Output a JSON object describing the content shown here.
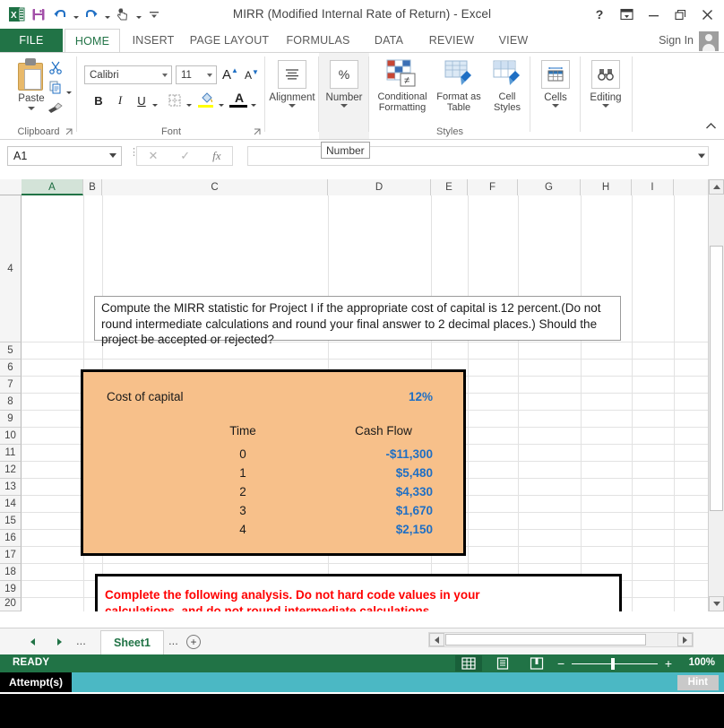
{
  "window": {
    "title": "MIRR (Modified Internal Rate of Return) - Excel",
    "help_icon": "?",
    "ribbon_display_icon": "ribbon-display-options-icon",
    "minimize_icon": "minimize-icon",
    "restore_icon": "restore-icon",
    "close_icon": "close-icon"
  },
  "quick_access": {
    "app_icon": "excel-app-icon",
    "save": "save-icon",
    "undo": "undo-icon",
    "redo": "redo-icon",
    "touch_mode": "touch-mouse-mode-icon",
    "customize": "customize-quick-access-icon"
  },
  "ribbon_tabs": [
    {
      "label": "FILE",
      "active": false
    },
    {
      "label": "HOME",
      "active": true
    },
    {
      "label": "INSERT",
      "active": false
    },
    {
      "label": "PAGE LAYOUT",
      "active": false
    },
    {
      "label": "FORMULAS",
      "active": false
    },
    {
      "label": "DATA",
      "active": false
    },
    {
      "label": "REVIEW",
      "active": false
    },
    {
      "label": "VIEW",
      "active": false
    }
  ],
  "account": {
    "sign_in": "Sign In",
    "avatar": "user-avatar-icon"
  },
  "ribbon": {
    "groups": [
      {
        "name": "Clipboard"
      },
      {
        "name": "Font"
      },
      {
        "name": "Styles"
      }
    ],
    "clipboard": {
      "paste_label": "Paste",
      "cut_icon": "scissors-icon",
      "copy_icon": "copy-icon",
      "format_painter_icon": "format-painter-icon",
      "group_label": "Clipboard"
    },
    "font": {
      "font_name": "Calibri",
      "font_size": "11",
      "grow_font": "A",
      "shrink_font": "A",
      "bold": "B",
      "italic": "I",
      "underline": "U",
      "borders_icon": "borders-icon",
      "fill_color_icon": "fill-color-icon",
      "font_color_icon": "font-color-icon",
      "group_label": "Font"
    },
    "alignment": {
      "label": "Alignment",
      "icon": "alignment-icon"
    },
    "number": {
      "label": "Number",
      "icon": "percent-icon"
    },
    "styles": {
      "conditional_formatting": "Conditional Formatting",
      "format_as_table": "Format as Table",
      "cell_styles": "Cell Styles",
      "group_label": "Styles"
    },
    "cells": {
      "label": "Cells",
      "icon": "cells-icon"
    },
    "editing": {
      "label": "Editing",
      "icon": "binoculars-icon"
    },
    "collapse_icon": "collapse-ribbon-icon"
  },
  "formula_bar": {
    "name_box_value": "A1",
    "cancel_icon": "cancel-icon",
    "enter_icon": "enter-icon",
    "function_icon": "fx",
    "formula_value": "",
    "expand_icon": "expand-formula-bar-icon"
  },
  "tooltip": {
    "text": "Number"
  },
  "sheet": {
    "columns": [
      "A",
      "B",
      "C",
      "D",
      "E",
      "F",
      "G",
      "H",
      "I"
    ],
    "selected_column": "A",
    "rows": [
      "4",
      "5",
      "6",
      "7",
      "8",
      "9",
      "10",
      "11",
      "12",
      "13",
      "14",
      "15",
      "16",
      "17",
      "18",
      "19",
      "20"
    ],
    "selected_cell": "A1",
    "question_text": "Compute the MIRR statistic for Project I if the appropriate cost of capital is 12 percent.(Do not round intermediate calculations and round your final answer to 2 decimal places.) Should the project be accepted or rejected?",
    "data_box": {
      "cost_of_capital_label": "Cost of capital",
      "cost_of_capital_value": "12%",
      "time_header": "Time",
      "cash_flow_header": "Cash Flow",
      "rows": [
        {
          "time": "0",
          "cash_flow": "-$11,300"
        },
        {
          "time": "1",
          "cash_flow": "$5,480"
        },
        {
          "time": "2",
          "cash_flow": "$4,330"
        },
        {
          "time": "3",
          "cash_flow": "$1,670"
        },
        {
          "time": "4",
          "cash_flow": "$2,150"
        }
      ],
      "fill_color": "#F7C08A",
      "value_color": "#1F6FC4"
    },
    "instruction_box": {
      "line1": "Complete the following analysis. Do not hard code values in your",
      "line2": "calculations, and do not round intermediate calculations.",
      "text_color": "#FF0000"
    }
  },
  "sheet_tabs": {
    "first_icon": "first-sheet-icon",
    "prev_icon": "previous-sheet-icon",
    "next_icon": "next-sheet-icon",
    "last_icon": "last-sheet-icon",
    "left_dots": "...",
    "right_dots": "...",
    "tabs": [
      {
        "label": "Sheet1",
        "active": true
      }
    ],
    "add_sheet": "+"
  },
  "status_bar": {
    "status": "READY",
    "view_normal": "normal-view-icon",
    "view_page_layout": "page-layout-view-icon",
    "view_page_break": "page-break-preview-icon",
    "zoom_out": "−",
    "zoom_in": "+",
    "zoom_level": "100%"
  },
  "attempt_bar": {
    "label": "Attempt(s)",
    "hint_label": "Hint",
    "bar_color": "#4BB8C4"
  }
}
